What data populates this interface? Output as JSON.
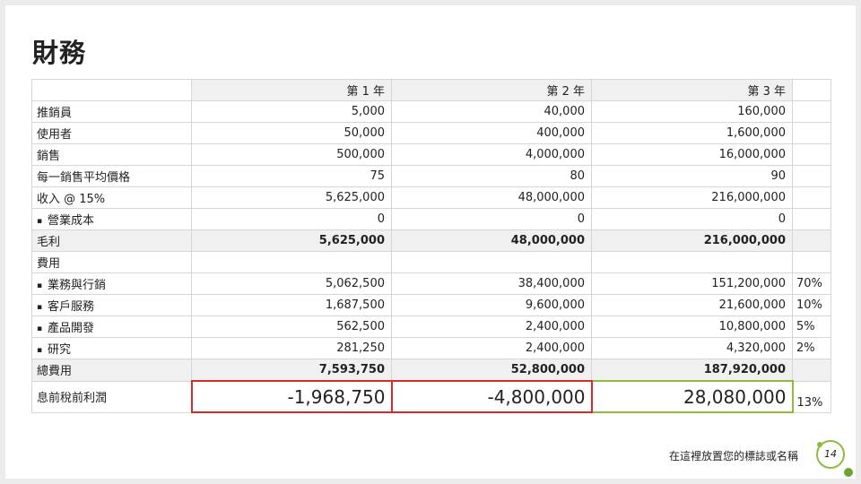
{
  "title": "財務",
  "headers": [
    "第 1 年",
    "第 2 年",
    "第 3 年"
  ],
  "rows": {
    "reps": {
      "label": "推銷員",
      "y1": "5,000",
      "y2": "40,000",
      "y3": "160,000"
    },
    "users": {
      "label": "使用者",
      "y1": "50,000",
      "y2": "400,000",
      "y3": "1,600,000"
    },
    "sales": {
      "label": "銷售",
      "y1": "500,000",
      "y2": "4,000,000",
      "y3": "16,000,000"
    },
    "avg_price": {
      "label": "每一銷售平均價格",
      "y1": "75",
      "y2": "80",
      "y3": "90"
    },
    "revenue": {
      "label": "收入 @ 15%",
      "y1": "5,625,000",
      "y2": "48,000,000",
      "y3": "216,000,000"
    },
    "cogs": {
      "label": "營業成本",
      "y1": "0",
      "y2": "0",
      "y3": "0"
    },
    "gross_profit": {
      "label": "毛利",
      "y1": "5,625,000",
      "y2": "48,000,000",
      "y3": "216,000,000"
    },
    "expenses_header": {
      "label": "費用"
    },
    "sales_marketing": {
      "label": "業務與行銷",
      "y1": "5,062,500",
      "y2": "38,400,000",
      "y3": "151,200,000",
      "pct": "70%"
    },
    "customer_service": {
      "label": "客戶服務",
      "y1": "1,687,500",
      "y2": "9,600,000",
      "y3": "21,600,000",
      "pct": "10%"
    },
    "product_dev": {
      "label": "產品開發",
      "y1": "562,500",
      "y2": "2,400,000",
      "y3": "10,800,000",
      "pct": "5%"
    },
    "research": {
      "label": "研究",
      "y1": "281,250",
      "y2": "2,400,000",
      "y3": "4,320,000",
      "pct": "2%"
    },
    "total_expenses": {
      "label": "總費用",
      "y1": "7,593,750",
      "y2": "52,800,000",
      "y3": "187,920,000"
    },
    "ebit": {
      "label": "息前稅前利潤",
      "y1": "-1,968,750",
      "y2": "-4,800,000",
      "y3": "28,080,000",
      "pct": "13%"
    }
  },
  "footer": {
    "text": "在這裡放置您的標誌或名稱",
    "page_number": "14"
  },
  "colors": {
    "negative_border": "#d72a2a",
    "positive_border": "#8fbc3f",
    "accent_green": "#6aa62e"
  }
}
